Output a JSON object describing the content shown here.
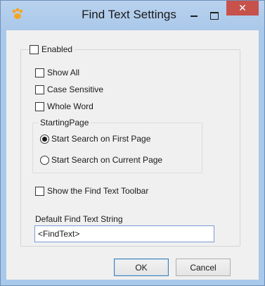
{
  "window": {
    "title": "Find Text Settings",
    "close_glyph": "✕",
    "accent": "#aac8ea",
    "close_color": "#c7514b"
  },
  "icons": [
    "app-paw-icon",
    "minimize-icon",
    "maximize-icon",
    "close-icon"
  ],
  "enabled": {
    "label": "Enabled",
    "checked": false
  },
  "options": {
    "show_all": {
      "label": "Show All",
      "checked": false
    },
    "case_sensitive": {
      "label": "Case Sensitive",
      "checked": false
    },
    "whole_word": {
      "label": "Whole Word",
      "checked": false
    }
  },
  "starting_page": {
    "label": "StartingPage",
    "first_page": {
      "label": "Start Search on First Page",
      "selected": true
    },
    "current_page": {
      "label": "Start Search on Current Page",
      "selected": false
    }
  },
  "toolbar_option": {
    "label": "Show the Find Text Toolbar",
    "checked": false
  },
  "default_string": {
    "label": "Default Find Text String",
    "value": "<FindText>"
  },
  "buttons": {
    "ok": "OK",
    "cancel": "Cancel"
  }
}
